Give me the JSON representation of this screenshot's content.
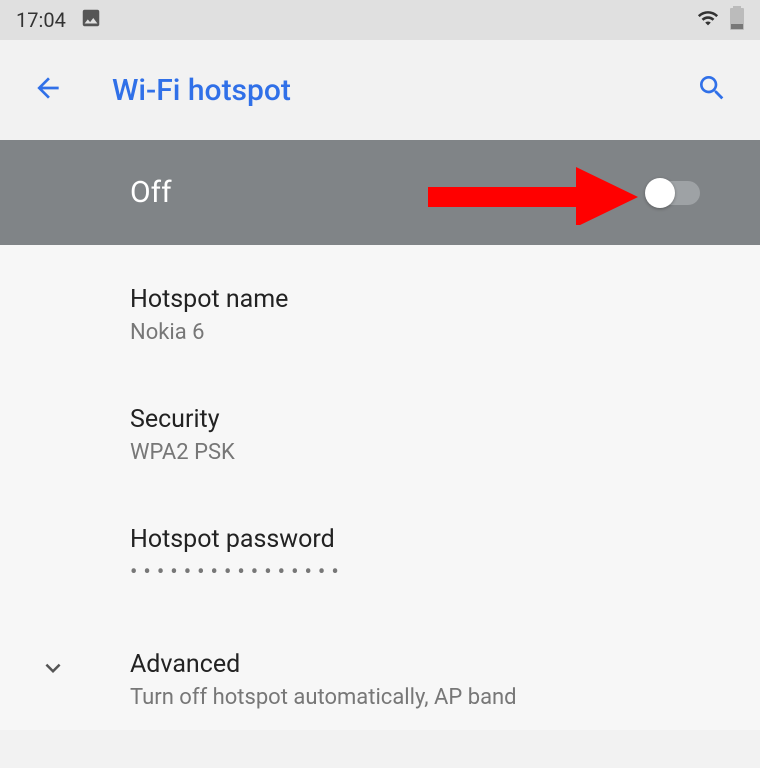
{
  "status": {
    "time": "17:04"
  },
  "header": {
    "title": "Wi-Fi hotspot"
  },
  "toggle": {
    "label": "Off",
    "state": "off"
  },
  "settings": {
    "hotspot_name": {
      "title": "Hotspot name",
      "value": "Nokia 6"
    },
    "security": {
      "title": "Security",
      "value": "WPA2 PSK"
    },
    "password": {
      "title": "Hotspot password",
      "masked": "••••••••••••••••"
    },
    "advanced": {
      "title": "Advanced",
      "subtitle": "Turn off hotspot automatically, AP band"
    }
  }
}
